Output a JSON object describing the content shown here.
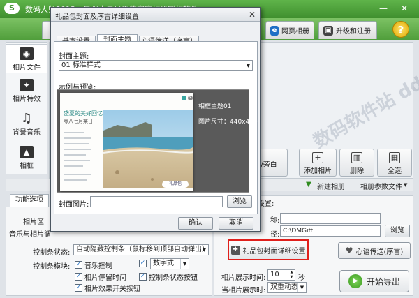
{
  "app": {
    "title": "数码大师2013 - 最强大最易用的家庭相册制作软件",
    "logo": "S",
    "minimize": "—",
    "close": "✕"
  },
  "top_tabs": [
    {
      "label": "网页相册",
      "icon": "e"
    },
    {
      "label": "升级和注册",
      "icon": "▣"
    }
  ],
  "help": "?",
  "sidebar": {
    "items": [
      {
        "label": "相片文件",
        "icon": "camera-icon",
        "glyph": "◉"
      },
      {
        "label": "相片特效",
        "icon": "effects-icon",
        "glyph": "✦"
      },
      {
        "label": "背景音乐",
        "icon": "music-icon",
        "glyph": "♫"
      },
      {
        "label": "相框",
        "icon": "frame-icon",
        "glyph": "▲"
      }
    ]
  },
  "actions": {
    "partial_label": "/旁白",
    "add_photo": "添加相片",
    "delete": "删除",
    "select_all": "全选"
  },
  "strip": {
    "new_album": "新建相册",
    "album_params": "相册参数文件",
    "arrow": "▼"
  },
  "lower": {
    "tab": "功能选项",
    "photo_area_label": "相片区",
    "music_photo_label": "音乐与相片循",
    "control_state_label": "控制条状态:",
    "control_state_value": "自动隐藏控制条（鼠标移到顶部自动弹出）",
    "control_module_label": "控制条模块:",
    "checks": {
      "music_control": "音乐控制",
      "numeric_style": "数字式",
      "photo_pause_time": "相片停留时间",
      "control_state_btn": "控制条状态按钮",
      "effect_switch_btn": "相片效果开关按钮"
    },
    "check_mark": "✓"
  },
  "right": {
    "settings_label": "设置:",
    "name_label": "称:",
    "path_label": "径:",
    "path_value": "C:\\DMGift",
    "browse": "浏览",
    "gift_settings": "礼品包封面详细设置",
    "heart_preface": "心语传送(序言)",
    "show_time_label": "相片展示时间:",
    "show_time_value": "10",
    "seconds": "秒",
    "show_mode_label": "当相片展示时:",
    "show_mode_value": "双重动态",
    "start_export": "开始导出"
  },
  "dialog": {
    "title": "礼品包封面及序言详细设置",
    "close": "✕",
    "tabs": [
      "基本设置",
      "封面主题",
      "心语传送（序言）"
    ],
    "cover_theme_label": "封面主题:",
    "cover_theme_value": "01 标准样式",
    "preview_label": "示例与预览:",
    "preview_card": {
      "headline": "盛夏的美好回忆",
      "subline": "零八七月某日",
      "tag": "礼品包",
      "badge": "i"
    },
    "frame_theme": "相框主题01",
    "photo_size": "图片尺寸：440x480",
    "cover_image_label": "封面图片:",
    "browse": "浏览",
    "ok": "确认",
    "cancel": "取消"
  },
  "watermark": "数码软件站 ddooo.com"
}
